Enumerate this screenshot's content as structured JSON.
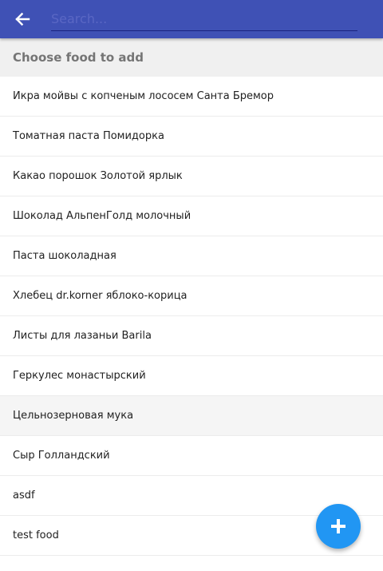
{
  "header": {
    "search_placeholder": "Search..."
  },
  "subheader": {
    "title": "Choose food to add"
  },
  "food_list": [
    "Икра мойвы с копченым лососем Санта Бремор",
    "Томатная паста Помидорка",
    "Какао порошок Золотой ярлык",
    "Шоколад АльпенГолд молочный",
    "Паста шоколадная",
    "Хлебец dr.korner яблоко-корица",
    "Листы для лазаньи Barila",
    "Геркулес монастырский",
    "Цельнозерновая мука",
    "Сыр Голландский",
    "asdf",
    "test food"
  ],
  "hovered_index": 8,
  "icons": {
    "back": "arrow-back-icon",
    "fab": "plus-icon"
  },
  "colors": {
    "appbar": "#3f51b5",
    "fab": "#2196f3",
    "subheader_bg": "#f0f0f0"
  }
}
